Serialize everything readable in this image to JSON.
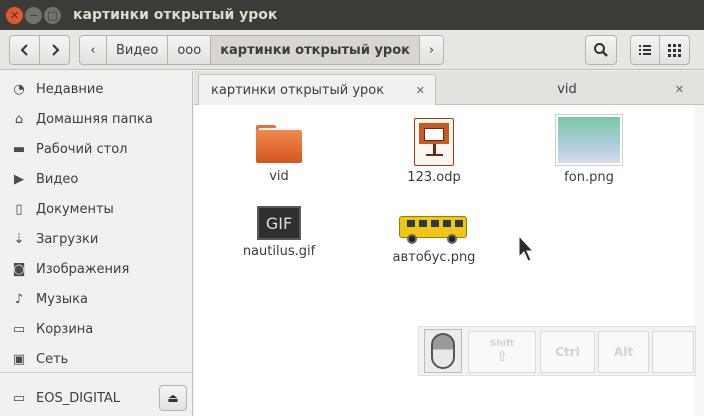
{
  "window": {
    "title": "картинки открытый урок",
    "close_glyph": "✕",
    "min_glyph": "−",
    "max_glyph": "□"
  },
  "toolbar": {
    "back_icon": "‹",
    "forward_icon": "›",
    "breadcrumb": [
      "Видео",
      "ooo",
      "картинки открытый урок"
    ],
    "crumb_left_arrow": "‹",
    "crumb_right_arrow": "›",
    "search_icon": "search-icon",
    "list_icon": "list-view-icon",
    "grid_icon": "grid-view-icon"
  },
  "sidebar": {
    "items": [
      {
        "label": "Недавние",
        "icon": "◔"
      },
      {
        "label": "Домашняя папка",
        "icon": "⌂"
      },
      {
        "label": "Рабочий стол",
        "icon": "▬"
      },
      {
        "label": "Видео",
        "icon": "▶"
      },
      {
        "label": "Документы",
        "icon": "▯"
      },
      {
        "label": "Загрузки",
        "icon": "⇣"
      },
      {
        "label": "Изображения",
        "icon": "◙"
      },
      {
        "label": "Музыка",
        "icon": "♪"
      },
      {
        "label": "Корзина",
        "icon": "▭"
      },
      {
        "label": "Сеть",
        "icon": "▣"
      }
    ],
    "device": {
      "label": "EOS_DIGITAL",
      "icon": "▭",
      "eject_icon": "⏏"
    }
  },
  "tabs": [
    {
      "label": "картинки открытый урок",
      "close": "✕",
      "active": true
    },
    {
      "label": "vid",
      "close": "✕",
      "active": false
    }
  ],
  "files": [
    {
      "name": "vid",
      "type": "folder"
    },
    {
      "name": "123.odp",
      "type": "odp"
    },
    {
      "name": "fon.png",
      "type": "png"
    },
    {
      "name": "nautilus.gif",
      "type": "gif",
      "icon_text": "GIF"
    },
    {
      "name": "автобус.png",
      "type": "bus"
    }
  ],
  "key_overlay": {
    "keys": [
      "Shift",
      "Ctrl",
      "Alt",
      ""
    ]
  },
  "colors": {
    "titlebar": "#3c3b37",
    "close_button": "#e0592a",
    "content_bg": "#ffffff"
  }
}
